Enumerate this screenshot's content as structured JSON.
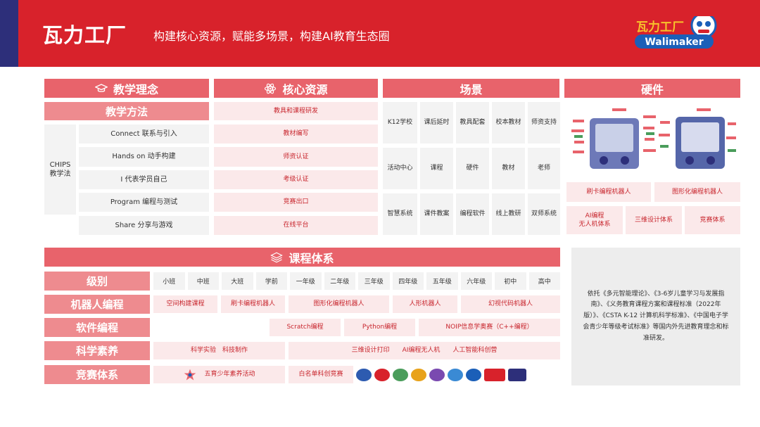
{
  "header": {
    "brand": "瓦力工厂",
    "slogan": "构建核心资源，赋能多场景，构建AI教育生态圈",
    "logo_text_cn": "瓦力工厂",
    "logo_text_en": "Walimaker"
  },
  "columns": {
    "philosophy": {
      "title": "教学理念",
      "sub_title": "教学方法",
      "method_label": "CHIPS\n教学法",
      "items": [
        "Connect 联系与引入",
        "Hands on 动手构建",
        "I 代表学员自己",
        "Program 编程与测试",
        "Share 分享与游戏"
      ]
    },
    "resources": {
      "title": "核心资源",
      "items": [
        "教具和课程研发",
        "教材编写",
        "师资认证",
        "考级认证",
        "竞赛出口",
        "在线平台"
      ]
    },
    "scenes": {
      "title": "场景",
      "rows": [
        [
          "K12学校",
          "课后延时",
          "教具配套",
          "校本教材",
          "师资支持"
        ],
        [
          "活动中心",
          "课程",
          "硬件",
          "教材",
          "老师"
        ],
        [
          "智慧系统",
          "课件教案",
          "编程软件",
          "线上教研",
          "双师系统"
        ]
      ]
    },
    "hardware": {
      "title": "硬件",
      "row1": [
        "刷卡编程机器人",
        "图形化编程机器人"
      ],
      "row2": [
        "AI编程\n无人机体系",
        "三维设计体系",
        "竞赛体系"
      ]
    }
  },
  "curriculum": {
    "title": "课程体系",
    "levels_label": "级别",
    "levels": [
      "小班",
      "中班",
      "大班",
      "学前",
      "一年级",
      "二年级",
      "三年级",
      "四年级",
      "五年级",
      "六年级",
      "初中",
      "高中"
    ],
    "robot": {
      "label": "机器人编程",
      "items": [
        "空间构建课程",
        "刷卡编程机器人",
        "图形化编程机器人",
        "人形机器人",
        "幻视代码机器人"
      ]
    },
    "software": {
      "label": "软件编程",
      "items": [
        "Scratch编程",
        "Python编程",
        "NOIP信息学奥赛（C++编程）"
      ]
    },
    "science": {
      "label": "科学素养",
      "items": [
        "科学实验　科技制作",
        "三维设计打印　　AI编程无人机　　人工智能科创营"
      ]
    },
    "competition": {
      "label": "竞赛体系",
      "items": [
        "五育少年素养活动",
        "白名单科创竞赛"
      ]
    }
  },
  "note": "依托《多元智能理论》、《3-6岁儿童学习与发展指南》、《义务教育课程方案和课程标准（2022年版）》、《CSTA K-12 计算机科学标准》、《中国电子学会青少年等级考试标准》等国内外先进教育理念和标准研发。",
  "colors": {
    "header_red": "#d8222b",
    "header_navy": "#2d2f7a",
    "bar": "#e8636b",
    "sub": "#ee8b8f",
    "pink_bg": "#fbe9ea",
    "pink_text": "#c8262e"
  }
}
